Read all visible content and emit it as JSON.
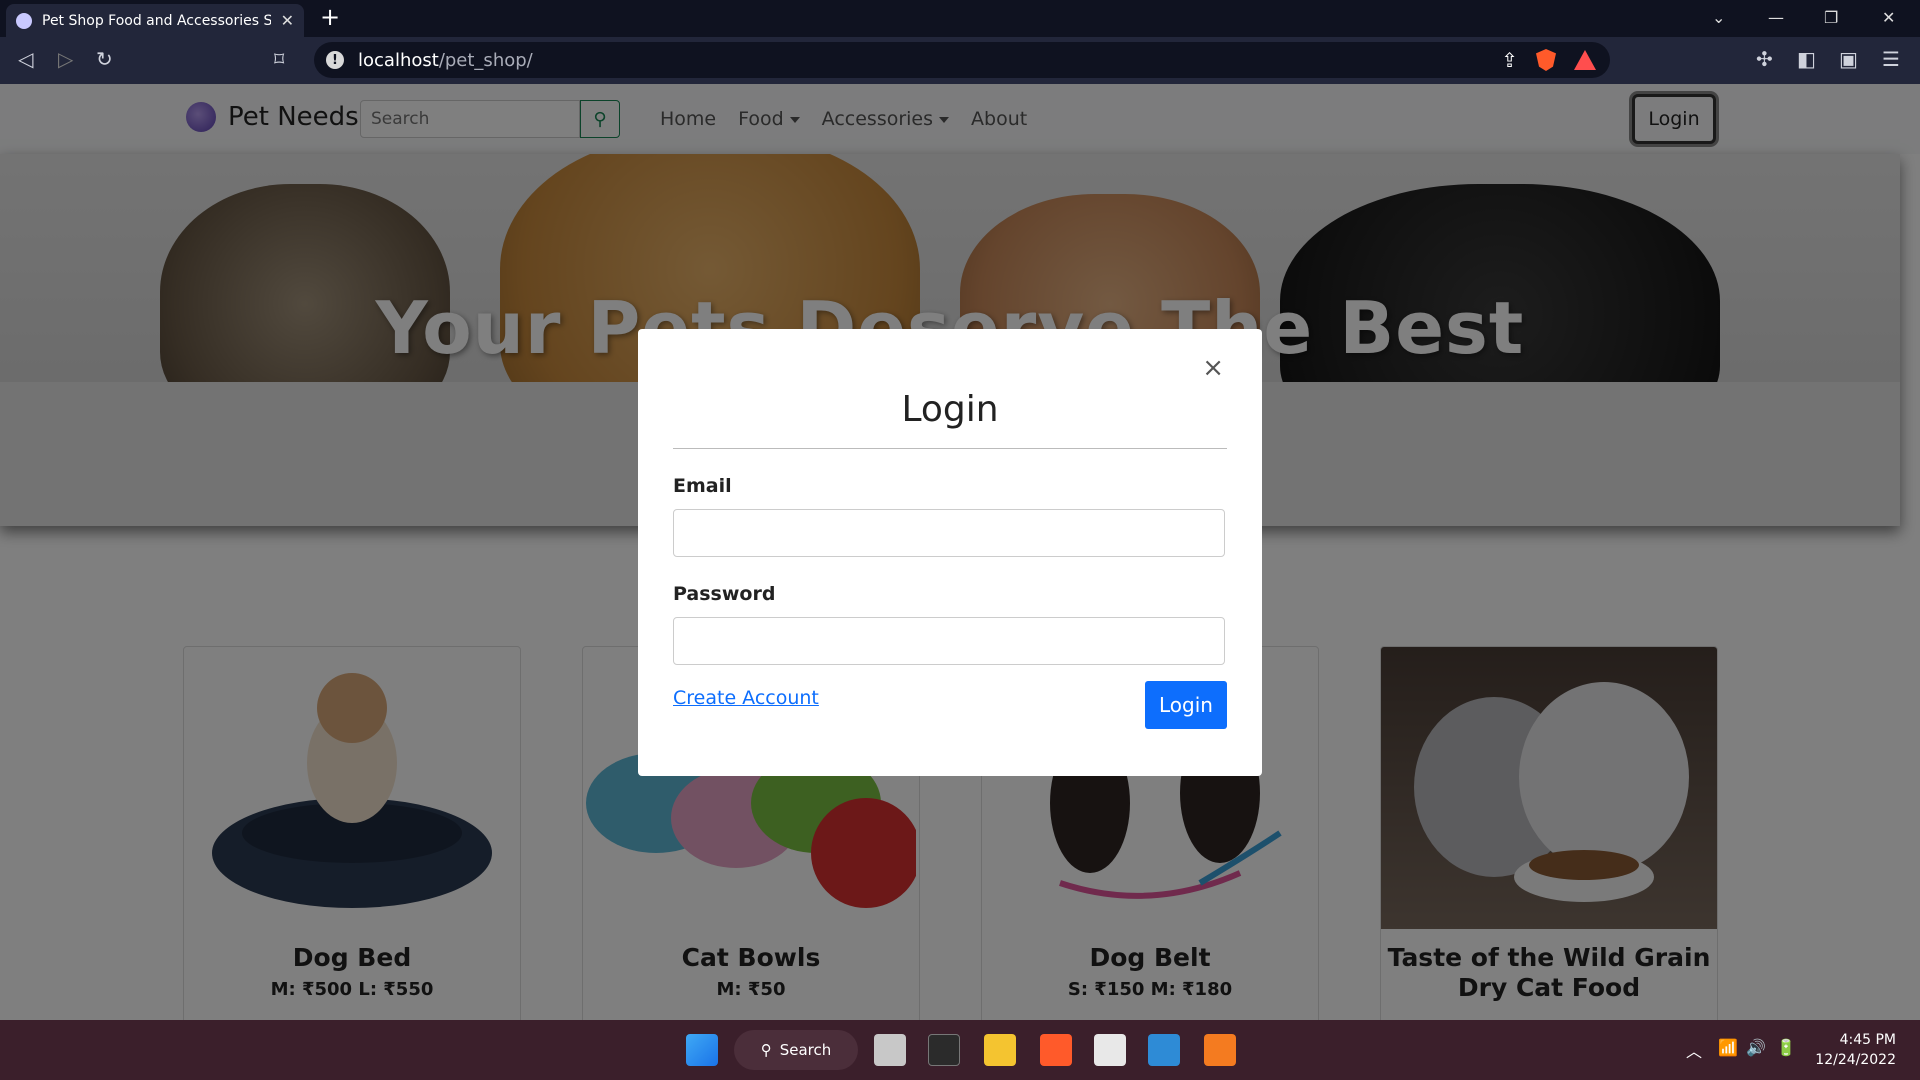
{
  "browser": {
    "tab_title": "Pet Shop Food and Accessories Sh",
    "url_host": "localhost",
    "url_path": "/pet_shop/"
  },
  "nav": {
    "brand": "Pet Needs",
    "search_placeholder": "Search",
    "links": [
      "Home",
      "Food",
      "Accessories",
      "About"
    ],
    "login": "Login"
  },
  "hero": {
    "title": "Your Pets Deserve The Best"
  },
  "cards": [
    {
      "title": "Dog Bed",
      "price": "M: ₹500 L: ₹550"
    },
    {
      "title": "Cat Bowls",
      "price": "M: ₹50"
    },
    {
      "title": "Dog Belt",
      "price": "S: ₹150 M: ₹180"
    },
    {
      "title": "Taste of the Wild Grain Dry Cat Food",
      "price": ""
    }
  ],
  "modal": {
    "title": "Login",
    "close": "×",
    "email_label": "Email",
    "password_label": "Password",
    "create_account": "Create Account",
    "login_button": "Login"
  },
  "taskbar": {
    "search": "Search",
    "time": "4:45 PM",
    "date": "12/24/2022"
  }
}
